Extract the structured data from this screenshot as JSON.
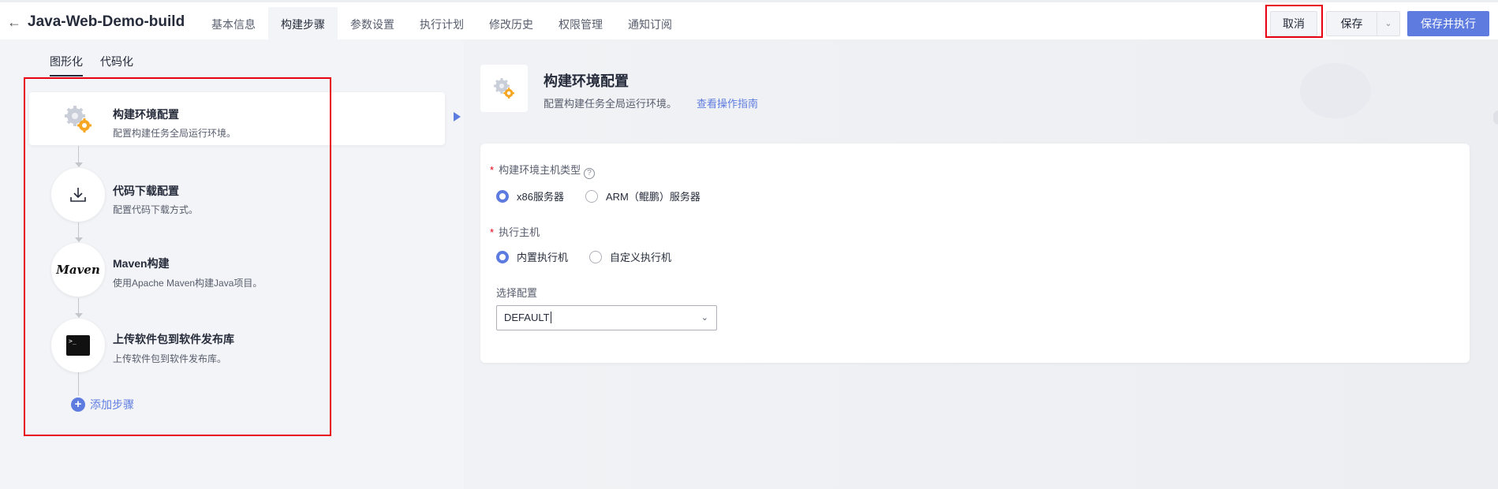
{
  "header": {
    "project_title": "Java-Web-Demo-build",
    "tabs": [
      {
        "label": "基本信息"
      },
      {
        "label": "构建步骤",
        "active": true
      },
      {
        "label": "参数设置"
      },
      {
        "label": "执行计划"
      },
      {
        "label": "修改历史"
      },
      {
        "label": "权限管理"
      },
      {
        "label": "通知订阅"
      }
    ],
    "buttons": {
      "cancel": "取消",
      "save": "保存",
      "save_and_run": "保存并执行"
    }
  },
  "editor_tabs": [
    {
      "label": "图形化",
      "active": true
    },
    {
      "label": "代码化"
    }
  ],
  "steps": [
    {
      "title": "构建环境配置",
      "desc": "配置构建任务全局运行环境。",
      "icon": "gear-icon",
      "selected": true
    },
    {
      "title": "代码下载配置",
      "desc": "配置代码下载方式。",
      "icon": "download-icon"
    },
    {
      "title": "Maven构建",
      "desc": "使用Apache Maven构建Java项目。",
      "icon": "maven-logo",
      "icon_text": "Maven"
    },
    {
      "title": "上传软件包到软件发布库",
      "desc": "上传软件包到软件发布库。",
      "icon": "terminal-icon",
      "icon_text": ">_"
    }
  ],
  "add_step_label": "添加步骤",
  "detail": {
    "title": "构建环境配置",
    "desc": "配置构建任务全局运行环境。",
    "guide_link": "查看操作指南",
    "host_type": {
      "label": "构建环境主机类型",
      "options": [
        {
          "label": "x86服务器",
          "checked": true
        },
        {
          "label": "ARM（鲲鹏）服务器",
          "checked": false
        }
      ]
    },
    "exec_host": {
      "label": "执行主机",
      "options": [
        {
          "label": "内置执行机",
          "checked": true
        },
        {
          "label": "自定义执行机",
          "checked": false
        }
      ]
    },
    "config": {
      "label": "选择配置",
      "value": "DEFAULT"
    }
  },
  "colors": {
    "accent": "#5e7ce0",
    "highlight_box": "#e60012"
  }
}
